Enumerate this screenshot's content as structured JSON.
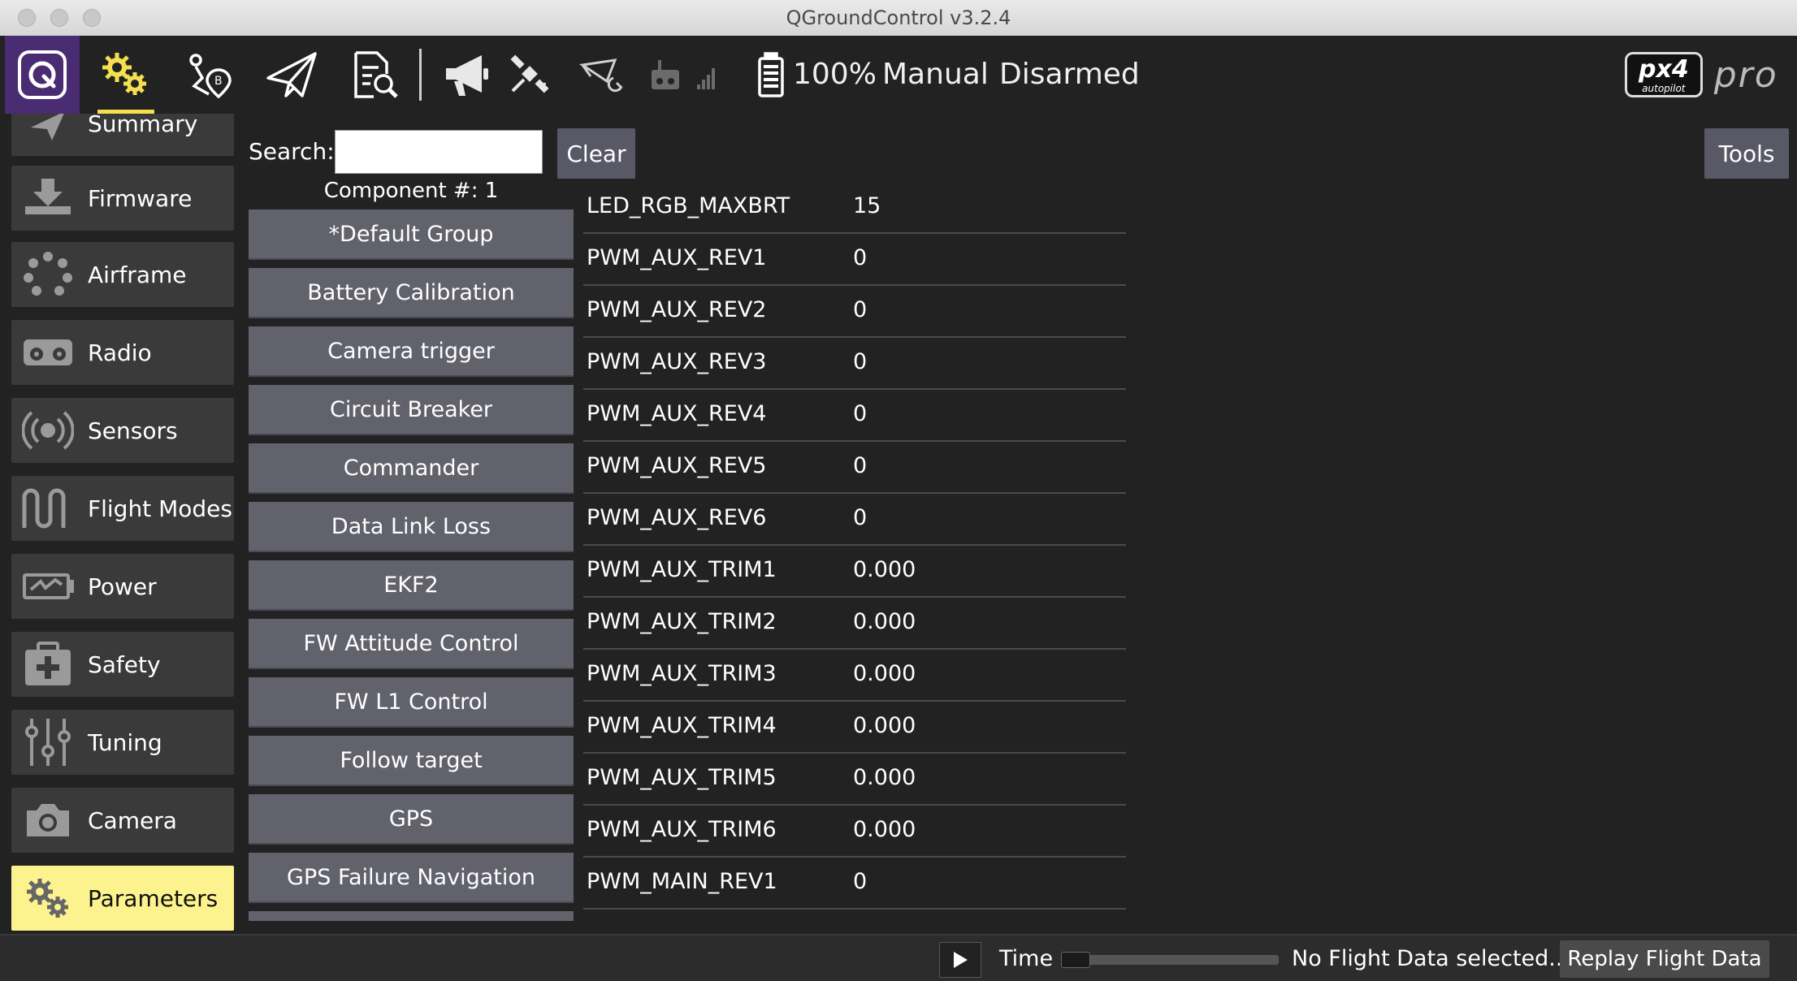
{
  "window": {
    "title": "QGroundControl v3.2.4"
  },
  "toolbar": {
    "icons": [
      "qgc-logo-icon",
      "vehicle-setup-icon",
      "plan-view-icon",
      "fly-view-icon",
      "analyze-view-icon",
      "messages-icon",
      "gps-icon",
      "rc-loss-icon",
      "telemetry-rssi-icon",
      "battery-icon"
    ],
    "battery_percent": "100%",
    "flight_mode": "Manual",
    "arm_state": "Disarmed",
    "brand_main": "px4",
    "brand_sub": "autopilot",
    "brand_pro": "pro",
    "accent_color": "#f4e04f",
    "qgc_button_color": "#4a2c72"
  },
  "sidebar": {
    "items": [
      {
        "label": "Summary",
        "icon": "airplane-icon"
      },
      {
        "label": "Firmware",
        "icon": "download-icon"
      },
      {
        "label": "Airframe",
        "icon": "airframe-icon"
      },
      {
        "label": "Radio",
        "icon": "radio-icon"
      },
      {
        "label": "Sensors",
        "icon": "sensors-icon"
      },
      {
        "label": "Flight Modes",
        "icon": "flight-modes-icon"
      },
      {
        "label": "Power",
        "icon": "power-icon"
      },
      {
        "label": "Safety",
        "icon": "safety-icon"
      },
      {
        "label": "Tuning",
        "icon": "tuning-icon"
      },
      {
        "label": "Camera",
        "icon": "camera-icon"
      },
      {
        "label": "Parameters",
        "icon": "gears-icon",
        "active": true
      }
    ],
    "active_color": "#fdf38e"
  },
  "search": {
    "label": "Search:",
    "value": "",
    "clear_label": "Clear"
  },
  "tools_label": "Tools",
  "component_label": "Component #: 1",
  "groups": [
    "*Default Group",
    "Battery Calibration",
    "Camera trigger",
    "Circuit Breaker",
    "Commander",
    "Data Link Loss",
    "EKF2",
    "FW Attitude Control",
    "FW L1 Control",
    "Follow target",
    "GPS",
    "GPS Failure Navigation"
  ],
  "params": [
    {
      "name": "LED_RGB_MAXBRT",
      "value": "15"
    },
    {
      "name": "PWM_AUX_REV1",
      "value": "0"
    },
    {
      "name": "PWM_AUX_REV2",
      "value": "0"
    },
    {
      "name": "PWM_AUX_REV3",
      "value": "0"
    },
    {
      "name": "PWM_AUX_REV4",
      "value": "0"
    },
    {
      "name": "PWM_AUX_REV5",
      "value": "0"
    },
    {
      "name": "PWM_AUX_REV6",
      "value": "0"
    },
    {
      "name": "PWM_AUX_TRIM1",
      "value": "0.000"
    },
    {
      "name": "PWM_AUX_TRIM2",
      "value": "0.000"
    },
    {
      "name": "PWM_AUX_TRIM3",
      "value": "0.000"
    },
    {
      "name": "PWM_AUX_TRIM4",
      "value": "0.000"
    },
    {
      "name": "PWM_AUX_TRIM5",
      "value": "0.000"
    },
    {
      "name": "PWM_AUX_TRIM6",
      "value": "0.000"
    },
    {
      "name": "PWM_MAIN_REV1",
      "value": "0"
    }
  ],
  "bottom_bar": {
    "time_label": "Time",
    "status": "No Flight Data selected..",
    "replay_label": "Replay Flight Data",
    "progress": 0
  }
}
